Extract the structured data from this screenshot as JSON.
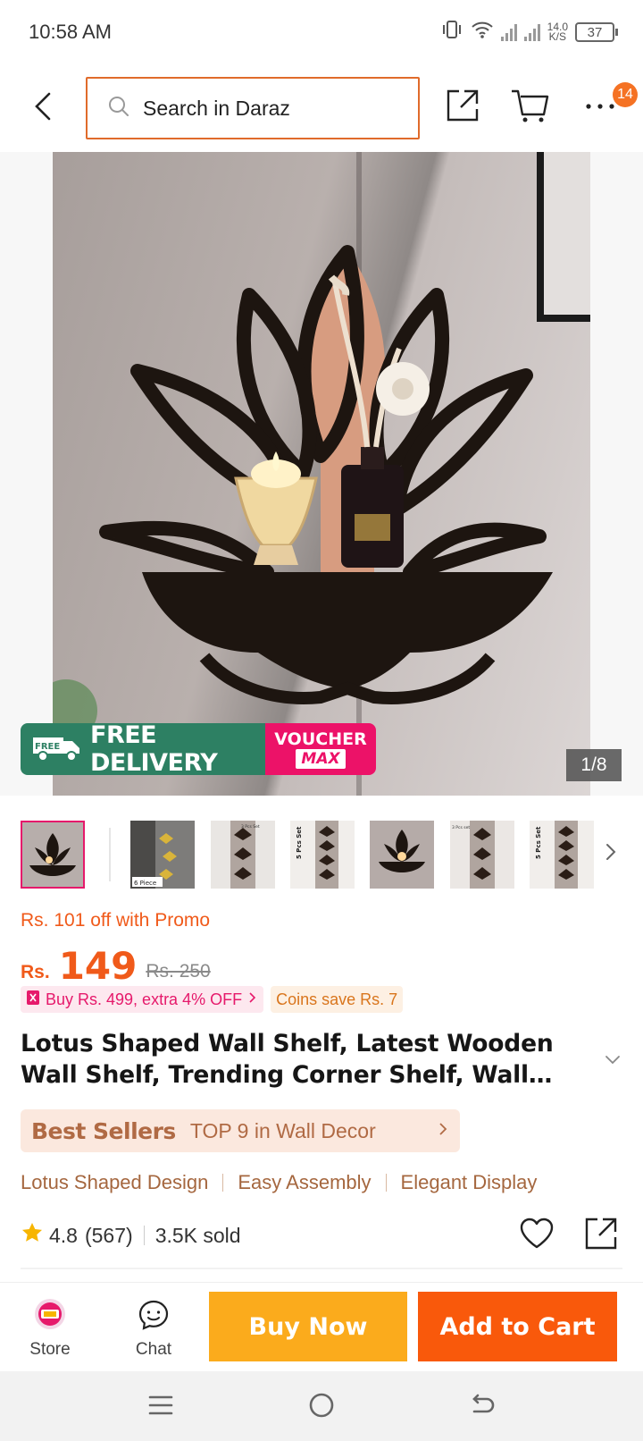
{
  "status_bar": {
    "time": "10:58 AM",
    "net_speed_value": "14.0",
    "net_speed_unit": "K/S",
    "battery": "37"
  },
  "top_nav": {
    "search_placeholder": "Search in Daraz",
    "cart_badge": "14"
  },
  "gallery": {
    "page_indicator": "1/8",
    "promo_free_delivery": "FREE DELIVERY",
    "promo_free_tag": "FREE",
    "promo_voucher_line1": "VOUCHER",
    "promo_voucher_line2": "MAX",
    "thumbnail_count": 7,
    "thumb_labels": [
      "6 Piece",
      "3 Pcs Set",
      "5 Pcs Set",
      "3 Pcs set",
      "5 Pcs Set"
    ]
  },
  "product": {
    "promo_text": "Rs. 101 off with Promo",
    "currency": "Rs.",
    "price": "149",
    "old_price": "Rs. 250",
    "chip_bundle": "Buy Rs. 499, extra 4% OFF",
    "chip_coins": "Coins save Rs. 7",
    "title": "Lotus Shaped Wall Shelf, Latest Wooden Wall Shelf, Trending Corner Shelf, Wall Decoration Items for Living Room",
    "best_sellers_label": "Best Sellers",
    "best_sellers_rank": "TOP 9 in Wall Decor",
    "features": [
      "Lotus Shaped Design",
      "Easy Assembly",
      "Elegant Display"
    ],
    "rating": "4.8",
    "review_count": "(567)",
    "sold": "3.5K sold"
  },
  "action_bar": {
    "store_label": "Store",
    "chat_label": "Chat",
    "buy_now_label": "Buy Now",
    "add_to_cart_label": "Add to Cart"
  },
  "colors": {
    "brand_orange": "#f57224",
    "price_orange": "#f05a1a",
    "buy_now": "#fbab1c",
    "add_to_cart": "#f9590b",
    "voucher_pink": "#ec1268",
    "delivery_green": "#2d8063"
  },
  "icons": [
    "back-arrow-icon",
    "search-icon",
    "share-icon",
    "cart-icon",
    "more-icon",
    "chevron-right-icon",
    "chevron-down-icon",
    "star-icon",
    "heart-icon",
    "store-icon",
    "chat-icon",
    "menu-icon",
    "home-icon",
    "back-icon"
  ]
}
